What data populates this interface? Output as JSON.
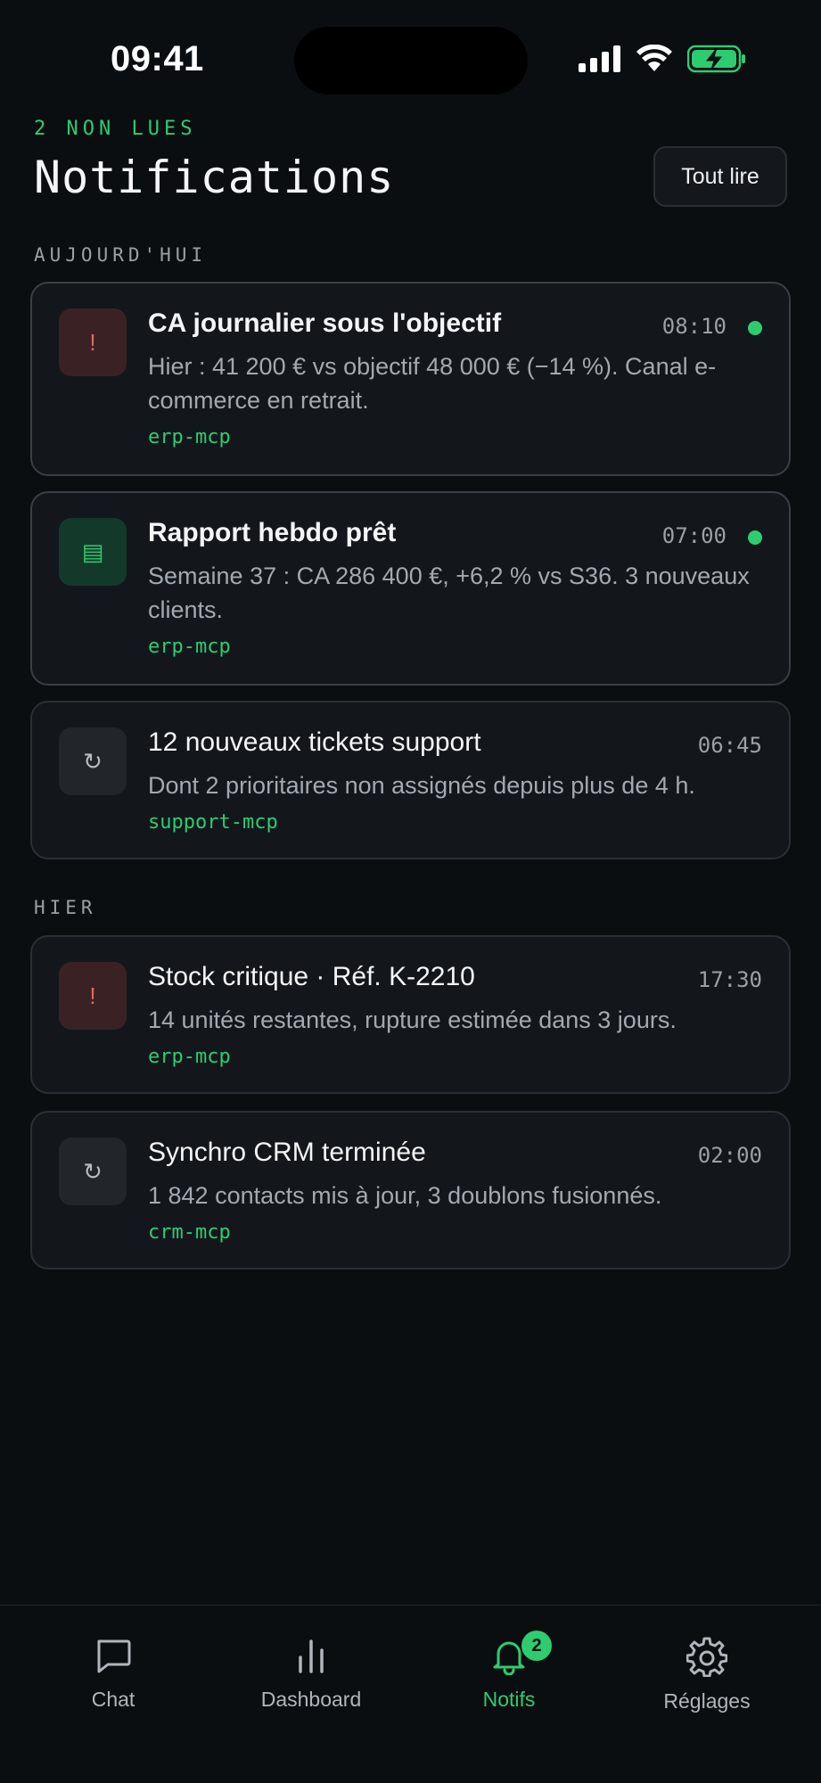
{
  "status": {
    "time": "09:41"
  },
  "header": {
    "unread_label": "2 NON LUES",
    "title": "Notifications",
    "read_all_label": "Tout lire"
  },
  "sections": {
    "today": "AUJOURD'HUI",
    "yesterday": "HIER"
  },
  "notifications": [
    {
      "icon": "alert-icon",
      "glyph": "!",
      "title": "CA journalier sous l'objectif",
      "time": "08:10",
      "unread": true,
      "body": "Hier : 41 200 € vs objectif 48 000 € (−14 %). Canal e-commerce en retrait.",
      "source": "erp-mcp"
    },
    {
      "icon": "report-icon",
      "glyph": "▤",
      "title": "Rapport hebdo prêt",
      "time": "07:00",
      "unread": true,
      "body": "Semaine 37 : CA 286 400 €, +6,2 % vs S36. 3 nouveaux clients.",
      "source": "erp-mcp"
    },
    {
      "icon": "sync-icon",
      "glyph": "↻",
      "title": "12 nouveaux tickets support",
      "time": "06:45",
      "unread": false,
      "body": "Dont 2 prioritaires non assignés depuis plus de 4 h.",
      "source": "support-mcp"
    },
    {
      "icon": "alert-icon",
      "glyph": "!",
      "title": "Stock critique · Réf. K-2210",
      "time": "17:30",
      "unread": false,
      "body": "14 unités restantes, rupture estimée dans 3 jours.",
      "source": "erp-mcp"
    },
    {
      "icon": "sync-icon",
      "glyph": "↻",
      "title": "Synchro CRM terminée",
      "time": "02:00",
      "unread": false,
      "body": "1 842 contacts mis à jour, 3 doublons fusionnés.",
      "source": "crm-mcp"
    }
  ],
  "tabs": [
    {
      "label": "Chat",
      "icon": "chat-icon"
    },
    {
      "label": "Dashboard",
      "icon": "chart-icon"
    },
    {
      "label": "Notifs",
      "icon": "bell-icon",
      "badge": "2",
      "active": true
    },
    {
      "label": "Réglages",
      "icon": "gear-icon"
    }
  ],
  "colors": {
    "accent": "#2ecc71",
    "background": "#0b0e11",
    "card": "#13171b",
    "alert": "#e0695f"
  }
}
